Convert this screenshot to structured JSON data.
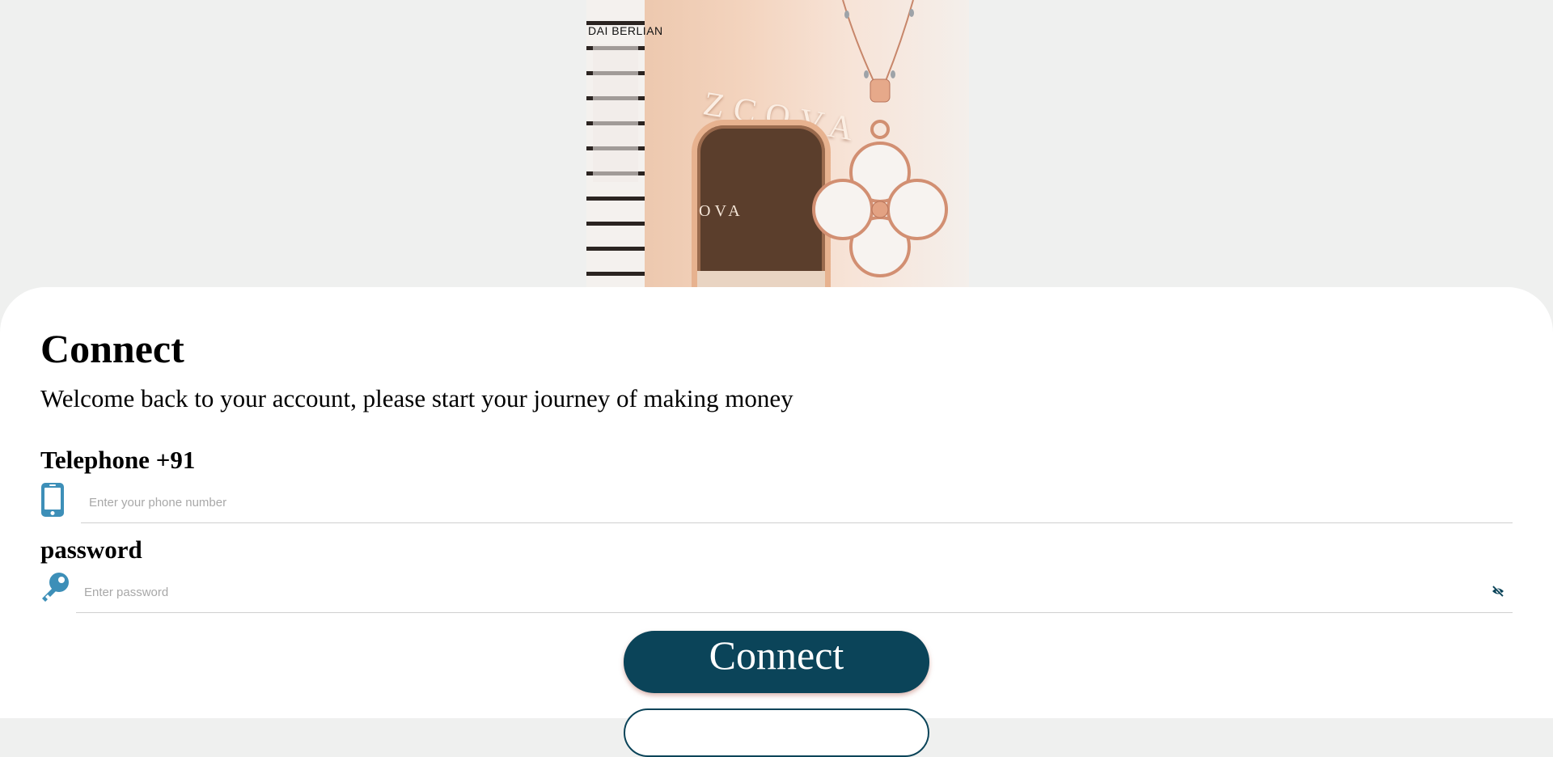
{
  "hero": {
    "store_sign": "DAI BERLIAN",
    "brand_sign": "ZCOVA",
    "inner_sign": "OVA"
  },
  "login": {
    "title": "Connect",
    "subtitle": "Welcome back to your account, please start your journey of making money",
    "phone": {
      "label": "Telephone +91",
      "placeholder": "Enter your phone number",
      "value": "",
      "icon": "phone-icon"
    },
    "password": {
      "label": "password",
      "placeholder": "Enter password",
      "value": "",
      "icon": "key-icon",
      "toggle_icon": "eye-slash-icon"
    },
    "connect_button": "Connect"
  },
  "colors": {
    "primary": "#0b4459",
    "icon": "#3d8fb8",
    "background": "#eff0ef",
    "card": "#ffffff"
  }
}
